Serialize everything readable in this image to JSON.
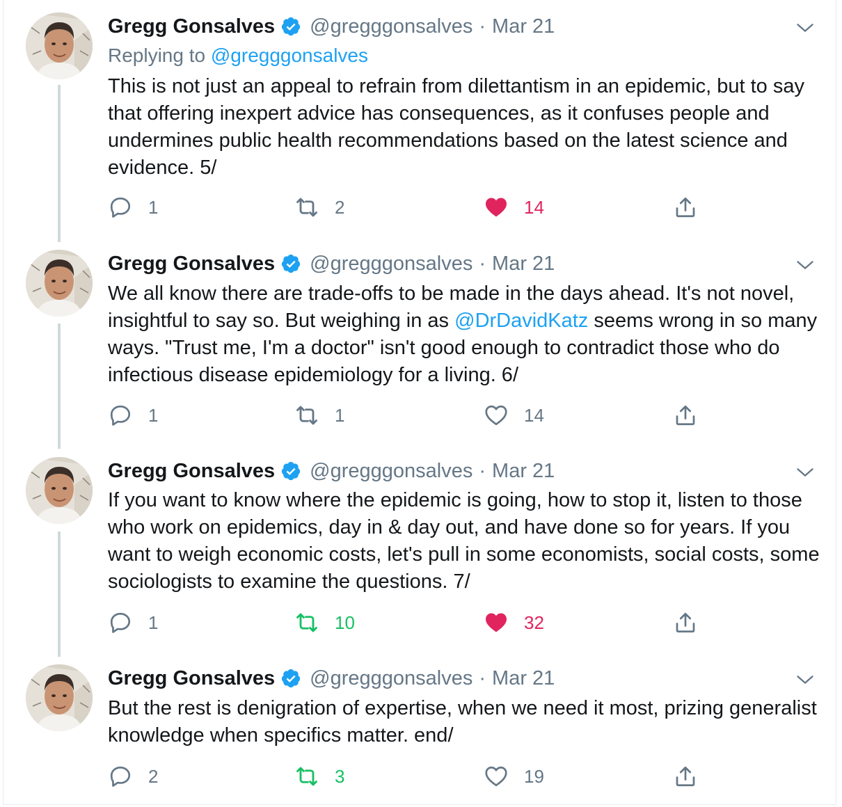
{
  "tweets": [
    {
      "author_name": "Gregg Gonsalves",
      "handle": "@gregggonsalves",
      "separator": "·",
      "date": "Mar 21",
      "replying_prefix": "Replying to",
      "replying_to": "@gregggonsalves",
      "text": "This is not just an appeal to refrain from dilettantism in an epidemic, but to say that offering inexpert advice has consequences, as it confuses people and undermines public health recommendations based on the latest science and evidence. 5/",
      "reply_count": "1",
      "retweet_count": "2",
      "like_count": "14",
      "liked": true,
      "retweeted": false
    },
    {
      "author_name": "Gregg Gonsalves",
      "handle": "@gregggonsalves",
      "separator": "·",
      "date": "Mar 21",
      "text_part1": "We all know there are trade-offs to be made in the days ahead. It's not novel, insightful to say so. But weighing in as ",
      "mention": "@DrDavidKatz",
      "text_part2": " seems wrong in so many ways. \"Trust me, I'm a doctor\" isn't good enough to contradict those who do infectious disease epidemiology for a living. 6/",
      "reply_count": "1",
      "retweet_count": "1",
      "like_count": "14",
      "liked": false,
      "retweeted": false
    },
    {
      "author_name": "Gregg Gonsalves",
      "handle": "@gregggonsalves",
      "separator": "·",
      "date": "Mar 21",
      "text": "If you want to know where the epidemic is going, how to stop it, listen to those who work on epidemics, day in & day out, and have done so for years. If you want to weigh economic costs, let's pull in some economists, social costs, some sociologists to examine the questions. 7/",
      "reply_count": "1",
      "retweet_count": "10",
      "like_count": "32",
      "liked": true,
      "retweeted": true
    },
    {
      "author_name": "Gregg Gonsalves",
      "handle": "@gregggonsalves",
      "separator": "·",
      "date": "Mar 21",
      "text": "But the rest is denigration of expertise, when we need it most, prizing generalist knowledge when specifics matter. end/",
      "reply_count": "2",
      "retweet_count": "3",
      "like_count": "19",
      "liked": false,
      "retweeted": true
    }
  ],
  "icons": {
    "verified": "verified-badge-icon",
    "reply": "reply-bubble-icon",
    "retweet": "retweet-icon",
    "like": "heart-icon",
    "share": "share-icon",
    "more": "chevron-down-icon"
  },
  "colors": {
    "accent": "#1da1f2",
    "like": "#e0245e",
    "retweet": "#17bf63",
    "secondary_text": "#657786"
  }
}
